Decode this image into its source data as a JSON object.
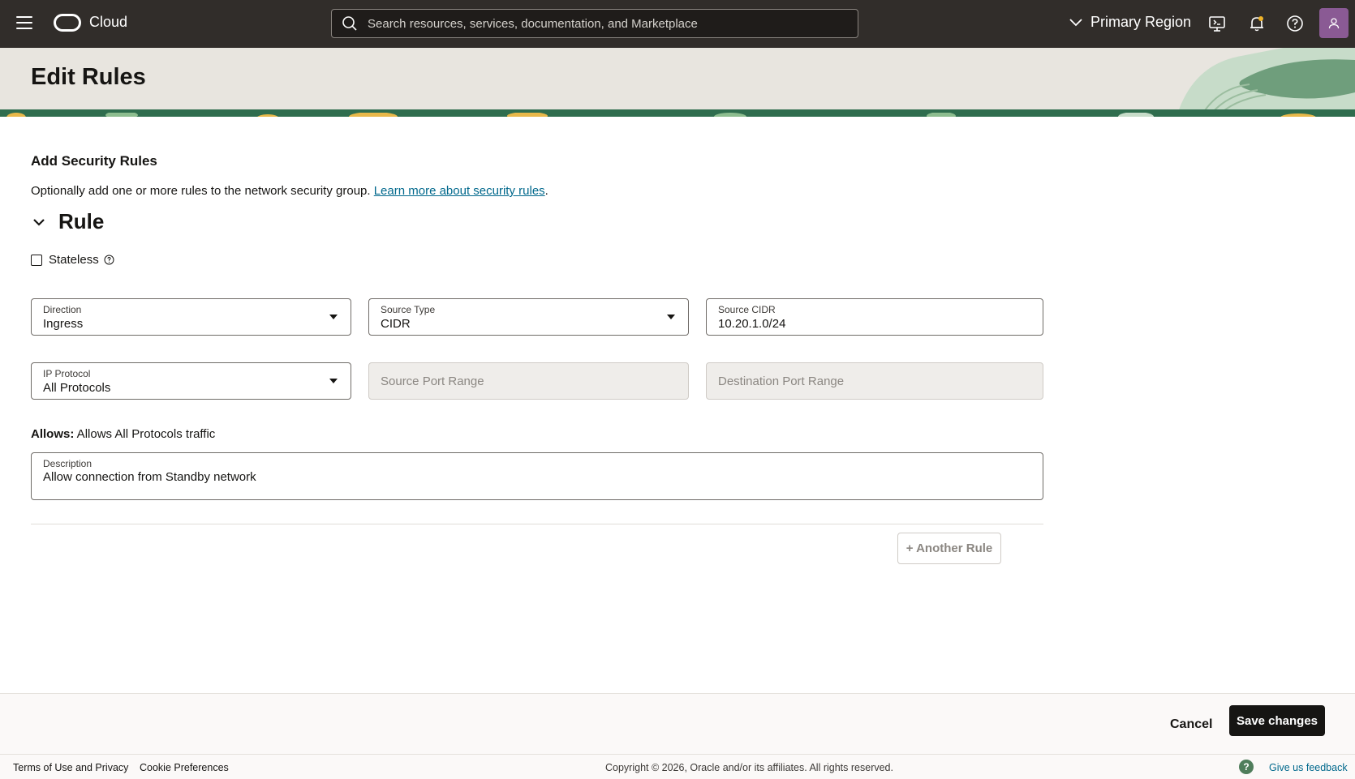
{
  "header": {
    "brand": "Cloud",
    "search_placeholder": "Search resources, services, documentation, and Marketplace",
    "region": "Primary Region"
  },
  "page": {
    "title": "Edit Rules"
  },
  "section": {
    "title": "Add Security Rules",
    "description": "Optionally add one or more rules to the network security group. ",
    "learn_more": "Learn more about security rules",
    "period": "."
  },
  "rule": {
    "title": "Rule",
    "stateless_label": "Stateless",
    "stateless_checked": false,
    "direction": {
      "label": "Direction",
      "value": "Ingress"
    },
    "source_type": {
      "label": "Source Type",
      "value": "CIDR"
    },
    "source_cidr": {
      "label": "Source CIDR",
      "value": "10.20.1.0/24"
    },
    "ip_protocol": {
      "label": "IP Protocol",
      "value": "All Protocols"
    },
    "source_port_range": {
      "placeholder": "Source Port Range"
    },
    "destination_port_range": {
      "placeholder": "Destination Port Range"
    },
    "allows_label": "Allows:",
    "allows_text": " Allows All Protocols traffic",
    "description": {
      "label": "Description",
      "value": "Allow connection from Standby network"
    },
    "another_rule": "+ Another Rule"
  },
  "actions": {
    "cancel": "Cancel",
    "save": "Save changes"
  },
  "footer": {
    "terms": "Terms of Use and Privacy",
    "cookies": "Cookie Preferences",
    "copyright": "Copyright © 2026, Oracle and/or its affiliates. All rights reserved.",
    "feedback": "Give us feedback"
  }
}
